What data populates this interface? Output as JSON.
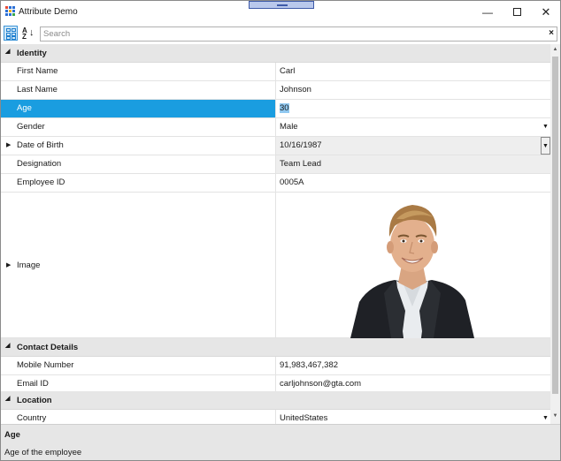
{
  "window": {
    "title": "Attribute Demo"
  },
  "toolbar": {
    "categorized_icon": "categorized-view-icon",
    "alphabetical_label_top": "A",
    "alphabetical_label_bottom": "Z",
    "alphabetical_arrow": "↓",
    "search_placeholder": "Search",
    "search_clear": "×"
  },
  "categories": {
    "identity": "Identity",
    "contact": "Contact Details",
    "location": "Location"
  },
  "properties": {
    "first_name": {
      "name": "First Name",
      "value": "Carl"
    },
    "last_name": {
      "name": "Last Name",
      "value": "Johnson"
    },
    "age": {
      "name": "Age",
      "value": "30"
    },
    "gender": {
      "name": "Gender",
      "value": "Male"
    },
    "dob": {
      "name": "Date of Birth",
      "value": "10/16/1987"
    },
    "designation": {
      "name": "Designation",
      "value": "Team Lead"
    },
    "employee_id": {
      "name": "Employee ID",
      "value": "0005A"
    },
    "image": {
      "name": "Image"
    },
    "mobile": {
      "name": "Mobile Number",
      "value": "91,983,467,382"
    },
    "email": {
      "name": "Email ID",
      "value": "carljohnson@gta.com"
    },
    "country": {
      "name": "Country",
      "value": "UnitedStates"
    }
  },
  "description": {
    "title": "Age",
    "text": "Age of the employee"
  },
  "colors": {
    "selection": "#1a9de0",
    "category_bg": "#e6e6e6",
    "description_bg": "#e6e6e6"
  }
}
